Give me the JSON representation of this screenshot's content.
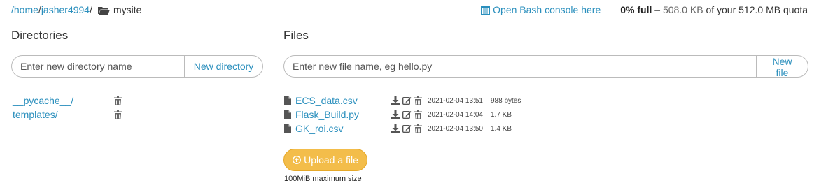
{
  "breadcrumb": {
    "home": "/home",
    "sep1": "/",
    "user": "jasher4994",
    "sep2": "/",
    "current": "mysite"
  },
  "header": {
    "console_link": "Open Bash console here",
    "quota_bold": "0% full",
    "quota_dash": " – ",
    "quota_used": "508.0 KB",
    "quota_rest": " of your 512.0 MB quota"
  },
  "directories": {
    "title": "Directories",
    "input_placeholder": "Enter new directory name",
    "button_label": "New directory",
    "items": [
      {
        "name": "__pycache__/"
      },
      {
        "name": "templates/"
      }
    ]
  },
  "files": {
    "title": "Files",
    "input_placeholder": "Enter new file name, eg hello.py",
    "button_label": "New file",
    "items": [
      {
        "name": "ECS_data.csv",
        "date": "2021-02-04 13:51",
        "size": "988 bytes"
      },
      {
        "name": "Flask_Build.py",
        "date": "2021-02-04 14:04",
        "size": "1.7 KB"
      },
      {
        "name": "GK_roi.csv",
        "date": "2021-02-04 13:50",
        "size": "1.4 KB"
      }
    ],
    "upload_label": "Upload a file",
    "upload_note": "100MiB maximum size"
  },
  "colors": {
    "link": "#2a8fbd",
    "upload_button": "#f3bd4a",
    "rule": "#cfe6f3"
  }
}
